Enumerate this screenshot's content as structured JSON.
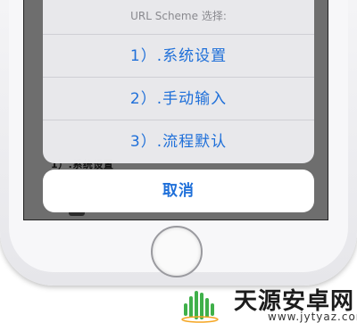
{
  "action_sheet": {
    "title": "URL Scheme 选择:",
    "options": [
      {
        "label": "1）.系统设置"
      },
      {
        "label": "2）.手动输入"
      },
      {
        "label": "3）.流程默认"
      }
    ],
    "cancel_label": "取消"
  },
  "background": {
    "partial_text": "1）.系统设置"
  },
  "watermark": {
    "brand_name": "天源安卓网",
    "url": "www.jytyaz.com",
    "logo_icon": "android-logo-icon",
    "logo_color": "#3fb04a"
  }
}
